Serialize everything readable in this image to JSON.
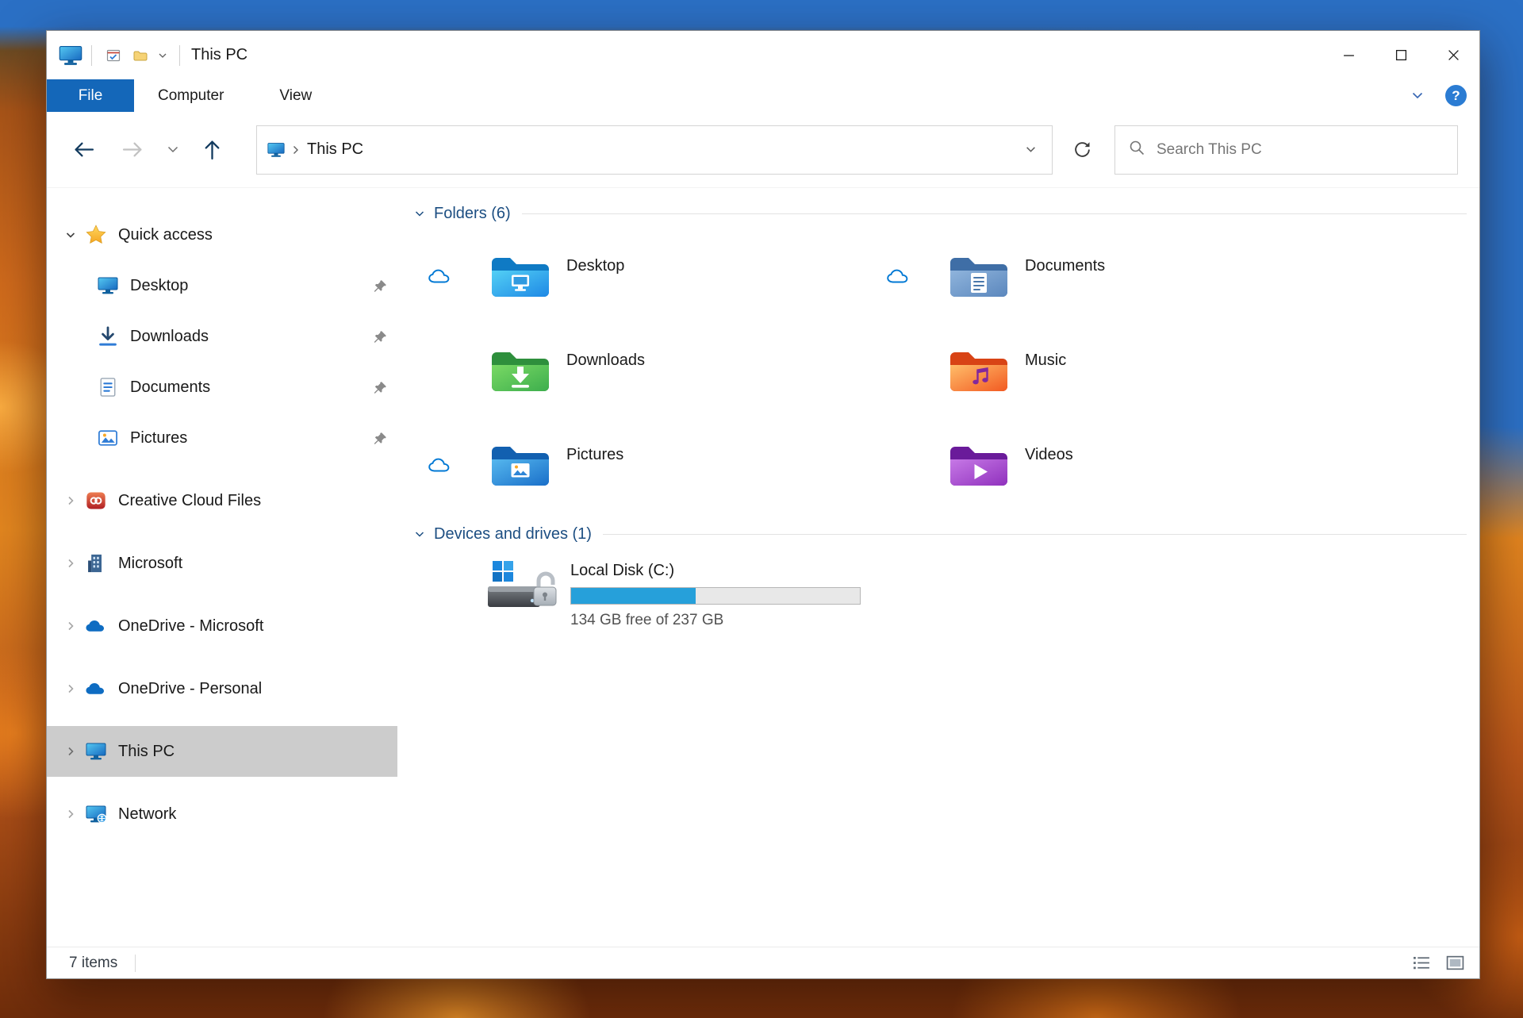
{
  "window": {
    "title": "This PC"
  },
  "ribbon": {
    "tabs": [
      "File",
      "Computer",
      "View"
    ],
    "help_glyph": "?"
  },
  "navbar": {
    "breadcrumb": "This PC",
    "search_placeholder": "Search This PC"
  },
  "sidebar": {
    "items": [
      {
        "label": "Quick access",
        "expanded": true
      },
      {
        "label": "Desktop",
        "pinned": true
      },
      {
        "label": "Downloads",
        "pinned": true
      },
      {
        "label": "Documents",
        "pinned": true
      },
      {
        "label": "Pictures",
        "pinned": true
      },
      {
        "label": "Creative Cloud Files"
      },
      {
        "label": "Microsoft"
      },
      {
        "label": "OneDrive - Microsoft"
      },
      {
        "label": "OneDrive - Personal"
      },
      {
        "label": "This PC",
        "selected": true
      },
      {
        "label": "Network"
      }
    ]
  },
  "content": {
    "folders_section": {
      "title": "Folders (6)"
    },
    "devices_section": {
      "title": "Devices and drives (1)"
    },
    "folders": [
      {
        "name": "Desktop",
        "cloud_status": true
      },
      {
        "name": "Documents",
        "cloud_status": true
      },
      {
        "name": "Downloads",
        "cloud_status": false
      },
      {
        "name": "Music",
        "cloud_status": false
      },
      {
        "name": "Pictures",
        "cloud_status": true
      },
      {
        "name": "Videos",
        "cloud_status": false
      }
    ],
    "drives": [
      {
        "name": "Local Disk (C:)",
        "free_text": "134 GB free of 237 GB",
        "used_percent": 43
      }
    ]
  },
  "statusbar": {
    "items_count": "7 items"
  },
  "icons": {
    "app": "monitor",
    "quick_access": "star",
    "onedrive": "cloud",
    "cloud_status": "cloud-outline",
    "pinned": "pushpin",
    "search": "magnifier",
    "refresh": "circular-arrow"
  },
  "colors": {
    "accent_blue": "#1467b9",
    "selection_gray": "#cccccc",
    "section_header_blue": "#1c4e82",
    "drive_bar_fill": "#26a0da"
  }
}
